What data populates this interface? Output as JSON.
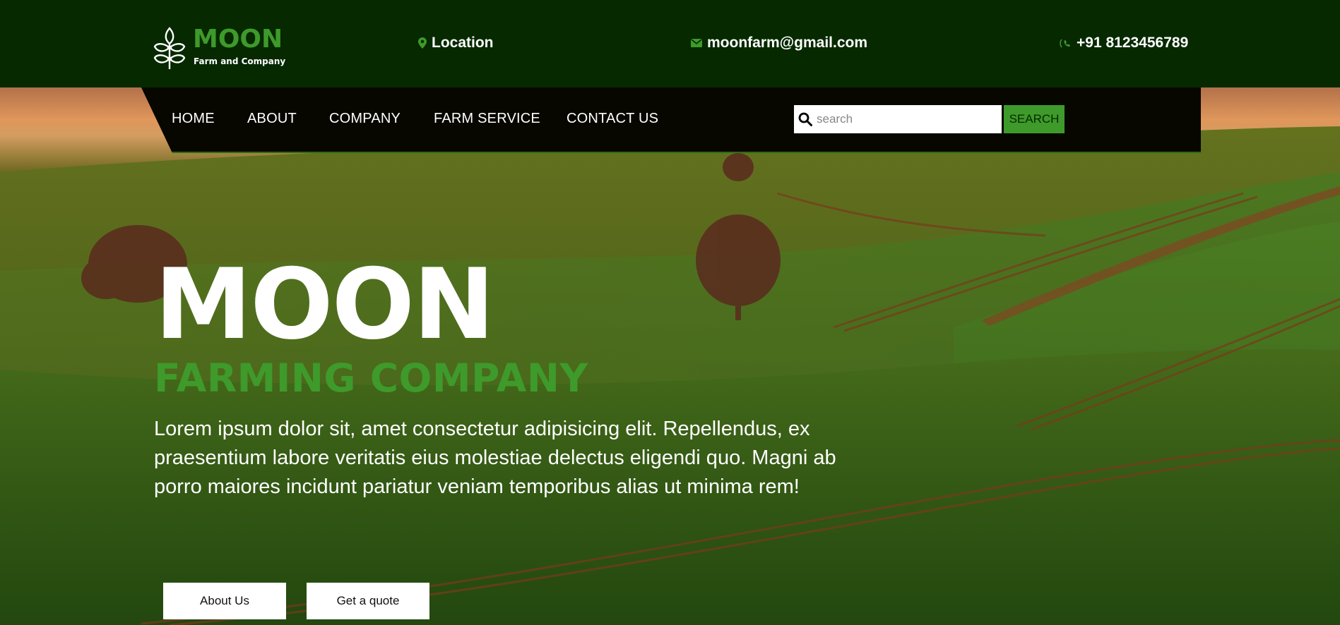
{
  "brand": {
    "name": "MOON",
    "tagline": "Farm and Company",
    "logo_icon": "wheat-icon"
  },
  "topbar": {
    "location": {
      "icon": "map-pin-icon",
      "text": "Location"
    },
    "email": {
      "icon": "envelope-icon",
      "text": "moonfarm@gmail.com"
    },
    "phone": {
      "icon": "phone-icon",
      "text": "+91 8123456789"
    }
  },
  "nav": {
    "items": [
      {
        "label": "HOME"
      },
      {
        "label": "ABOUT"
      },
      {
        "label": "COMPANY"
      },
      {
        "label": "FARM SERVICE"
      },
      {
        "label": "CONTACT US"
      }
    ],
    "search": {
      "icon": "search-icon",
      "placeholder": "search",
      "button_label": "SEARCH"
    }
  },
  "hero": {
    "title": "MOON",
    "subtitle": "FARMING COMPANY",
    "paragraph": "Lorem ipsum dolor sit, amet consectetur adipisicing elit. Repellendus, ex praesentium labore veritatis eius molestiae delectus eligendi quo. Magni ab porro maiores incidunt pariatur veniam temporibus alias ut minima rem!",
    "buttons": [
      {
        "label": "About Us"
      },
      {
        "label": "Get a quote"
      }
    ]
  },
  "colors": {
    "primary_dark": "#062900",
    "accent_green": "#3e9a2a",
    "nav_bg": "#070700",
    "text_light": "#ffffff"
  }
}
